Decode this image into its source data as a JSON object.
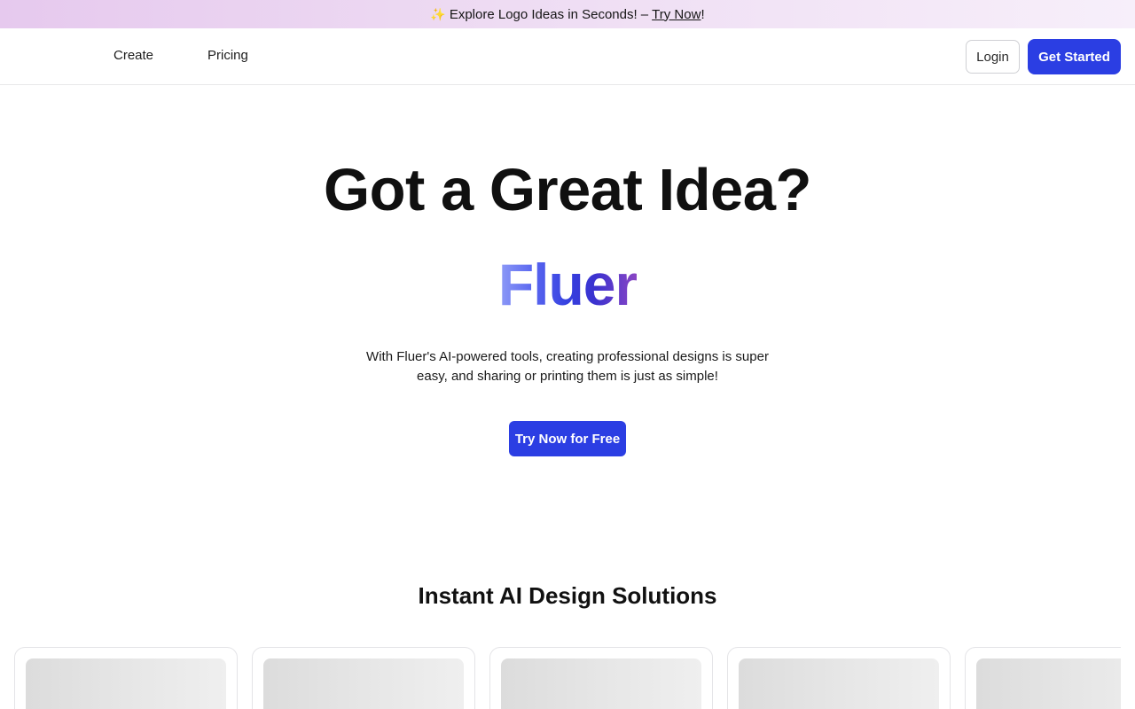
{
  "banner": {
    "sparkle": "✨",
    "text": "Explore Logo Ideas in Seconds! –",
    "link": "Try Now",
    "suffix": "!"
  },
  "nav": {
    "links": [
      "Create",
      "Pricing"
    ],
    "login": "Login",
    "get_started": "Get Started"
  },
  "hero": {
    "title": "Got a Great Idea?",
    "brand": "Fluer",
    "description": "With Fluer's AI-powered tools, creating professional designs is super easy, and sharing or printing them is just as simple!",
    "cta": "Try Now for Free"
  },
  "section": {
    "title": "Instant AI Design Solutions",
    "card_count": 5
  },
  "colors": {
    "primary": "#2b3ee3",
    "banner_start": "#e6c9ee",
    "banner_end": "#f7effa"
  }
}
